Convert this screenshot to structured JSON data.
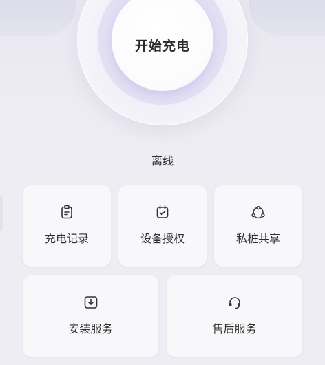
{
  "hero": {
    "start_button_label": "开始充电"
  },
  "status": {
    "text": "离线"
  },
  "menu": {
    "row1": [
      {
        "label": "充电记录",
        "icon": "clipboard-icon"
      },
      {
        "label": "设备授权",
        "icon": "calendar-check-icon"
      },
      {
        "label": "私桩共享",
        "icon": "share-nodes-icon"
      }
    ],
    "row2": [
      {
        "label": "安装服务",
        "icon": "download-box-icon"
      },
      {
        "label": "售后服务",
        "icon": "headset-icon"
      }
    ]
  },
  "colors": {
    "background": "#eeedf3",
    "card": "#f8f8fb",
    "text": "#2f2f2f",
    "accent_ring": "#dcd8f2"
  }
}
